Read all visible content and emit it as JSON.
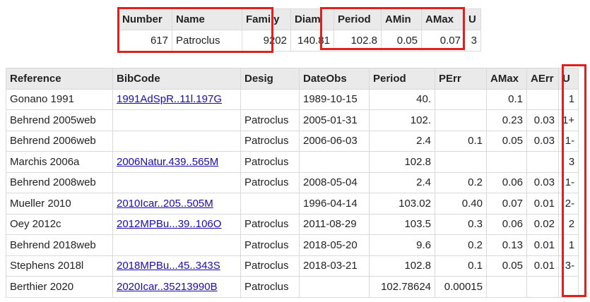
{
  "colors": {
    "highlight": "#e0201e",
    "header_bg": "#eaeaea",
    "link": "#1a0dab"
  },
  "summary": {
    "headers": [
      "Number",
      "Name",
      "Family",
      "Diam",
      "Period",
      "AMin",
      "AMax",
      "U"
    ],
    "values": [
      "617",
      "Patroclus",
      "9202",
      "140.81",
      "102.8",
      "0.05",
      "0.07",
      "3"
    ]
  },
  "references": {
    "headers": [
      "Reference",
      "BibCode",
      "Desig",
      "DateObs",
      "Period",
      "PErr",
      "AMax",
      "AErr",
      "U"
    ],
    "rows": [
      [
        "Gonano 1991",
        "1991AdSpR..11l.197G",
        "",
        "1989-10-15",
        "40.",
        "",
        "0.1",
        "",
        "1"
      ],
      [
        "Behrend 2005web",
        "",
        "Patroclus",
        "2005-01-31",
        "102.",
        "",
        "0.23",
        "0.03",
        "1+"
      ],
      [
        "Behrend 2006web",
        "",
        "Patroclus",
        "2006-06-03",
        "2.4",
        "0.1",
        "0.05",
        "0.03",
        "1-"
      ],
      [
        "Marchis 2006a",
        "2006Natur.439..565M",
        "Patroclus",
        "",
        "102.8",
        "",
        "",
        "",
        "3"
      ],
      [
        "Behrend 2008web",
        "",
        "Patroclus",
        "2008-05-04",
        "2.4",
        "0.2",
        "0.06",
        "0.03",
        "1-"
      ],
      [
        "Mueller 2010",
        "2010Icar..205..505M",
        "",
        "1996-04-14",
        "103.02",
        "0.40",
        "0.07",
        "0.01",
        "2-"
      ],
      [
        "Oey 2012c",
        "2012MPBu...39..106O",
        "Patroclus",
        "2011-08-29",
        "103.5",
        "0.3",
        "0.06",
        "0.02",
        "2"
      ],
      [
        "Behrend 2018web",
        "",
        "Patroclus",
        "2018-05-20",
        "9.6",
        "0.2",
        "0.13",
        "0.01",
        "1"
      ],
      [
        "Stephens 2018l",
        "2018MPBu...45..343S",
        "Patroclus",
        "2018-03-21",
        "102.8",
        "0.1",
        "0.05",
        "0.01",
        "3-"
      ],
      [
        "Berthier 2020",
        "2020Icar..35213990B",
        "Patroclus",
        "",
        "102.78624",
        "0.00015",
        "",
        "",
        ""
      ]
    ]
  }
}
